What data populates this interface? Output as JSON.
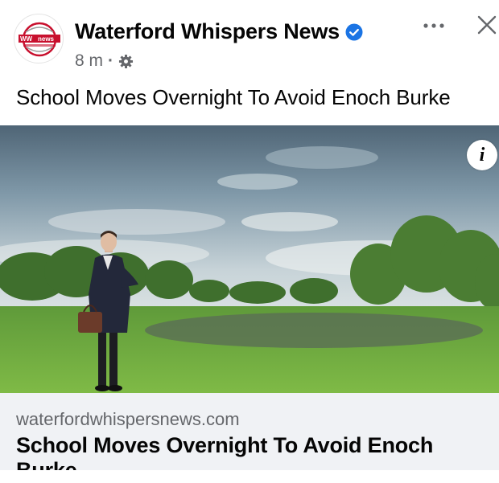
{
  "post": {
    "page_name": "Waterford Whispers News",
    "verified": true,
    "time": "8 m",
    "separator": "·",
    "audience_icon": "settings-gear-icon",
    "text": "School Moves Overnight To Avoid Enoch Burke"
  },
  "avatar": {
    "logo_text_left": "WW",
    "logo_text_right": "news",
    "logo_tagline": "Waterford Whispers News"
  },
  "icons": {
    "verified": "verified-badge-icon",
    "more": "more-options-icon",
    "close": "close-icon",
    "info": "info-icon"
  },
  "info_glyph": "i",
  "link_card": {
    "domain": "waterfordwhispersnews.com",
    "title": "School Moves Overnight To Avoid Enoch Burke"
  },
  "colors": {
    "verified_blue": "#1b74e4",
    "secondary_text": "#65676b",
    "card_background": "#f0f2f5",
    "logo_red": "#c8102e"
  }
}
